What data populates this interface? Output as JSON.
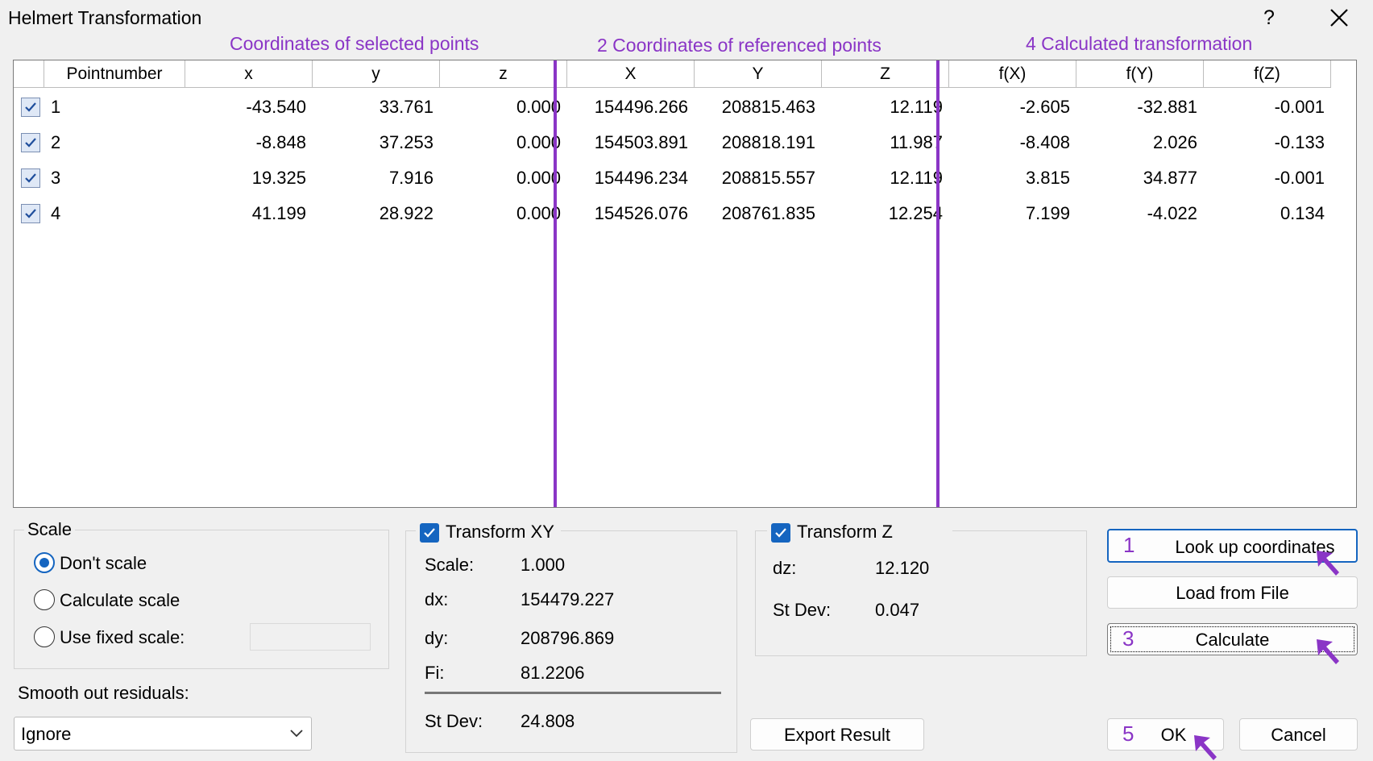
{
  "window": {
    "title": "Helmert Transformation",
    "help": "?"
  },
  "annotations": {
    "selected": "Coordinates of selected points",
    "referenced": "2 Coordinates of referenced points",
    "calculated": "4 Calculated transformation"
  },
  "grid": {
    "headers": [
      "Pointnumber",
      "x",
      "y",
      "z",
      "X",
      "Y",
      "Z",
      "f(X)",
      "f(Y)",
      "f(Z)"
    ],
    "rows": [
      {
        "checked": true,
        "num": "1",
        "x": "-43.540",
        "y": "33.761",
        "z": "0.000",
        "X": "154496.266",
        "Y": "208815.463",
        "Z": "12.119",
        "fX": "-2.605",
        "fY": "-32.881",
        "fZ": "-0.001"
      },
      {
        "checked": true,
        "num": "2",
        "x": "-8.848",
        "y": "37.253",
        "z": "0.000",
        "X": "154503.891",
        "Y": "208818.191",
        "Z": "11.987",
        "fX": "-8.408",
        "fY": "2.026",
        "fZ": "-0.133"
      },
      {
        "checked": true,
        "num": "3",
        "x": "19.325",
        "y": "7.916",
        "z": "0.000",
        "X": "154496.234",
        "Y": "208815.557",
        "Z": "12.119",
        "fX": "3.815",
        "fY": "34.877",
        "fZ": "-0.001"
      },
      {
        "checked": true,
        "num": "4",
        "x": "41.199",
        "y": "28.922",
        "z": "0.000",
        "X": "154526.076",
        "Y": "208761.835",
        "Z": "12.254",
        "fX": "7.199",
        "fY": "-4.022",
        "fZ": "0.134"
      }
    ]
  },
  "scale": {
    "label": "Scale",
    "options": [
      "Don't scale",
      "Calculate scale",
      "Use fixed scale:"
    ],
    "selected": "Don't scale",
    "fixed_value": ""
  },
  "smooth": {
    "label": "Smooth out residuals:",
    "value": "Ignore"
  },
  "transformXY": {
    "label": "Transform XY",
    "checked": true,
    "scale_label": "Scale:",
    "scale": "1.000",
    "dx_label": "dx:",
    "dx": "154479.227",
    "dy_label": "dy:",
    "dy": "208796.869",
    "fi_label": "Fi:",
    "fi": "81.2206",
    "stdev_label": "St Dev:",
    "stdev": "24.808"
  },
  "transformZ": {
    "label": "Transform Z",
    "checked": true,
    "dz_label": "dz:",
    "dz": "12.120",
    "stdev_label": "St Dev:",
    "stdev": "0.047"
  },
  "buttons": {
    "lookup": {
      "step": "1",
      "label": "Look up coordinates"
    },
    "load": {
      "label": "Load from File"
    },
    "calculate": {
      "step": "3",
      "label": "Calculate"
    },
    "export": {
      "label": "Export Result"
    },
    "ok": {
      "step": "5",
      "label": "OK"
    },
    "cancel": {
      "label": "Cancel"
    }
  },
  "colors": {
    "annotation": "#8a35c6",
    "accent": "#1565c0"
  }
}
